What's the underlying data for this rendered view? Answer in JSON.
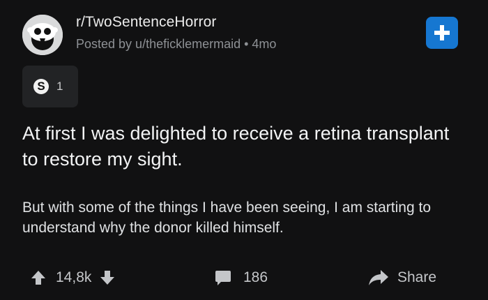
{
  "post": {
    "subreddit": "r/TwoSentenceHorror",
    "posted_by": "Posted by u/theficklemermaid",
    "age": "4mo",
    "award_count": "1",
    "award_icon": "award-s-icon",
    "title": "At first I was delighted to receive a retina transplant to restore my sight.",
    "body": "But with some of the things I have been seeing, I am starting to understand why the donor killed himself."
  },
  "actions": {
    "vote_count": "14,8k",
    "comment_count": "186",
    "share_label": "Share"
  },
  "colors": {
    "background": "#111112",
    "join_button": "#1677d1",
    "award_background": "#222325"
  }
}
